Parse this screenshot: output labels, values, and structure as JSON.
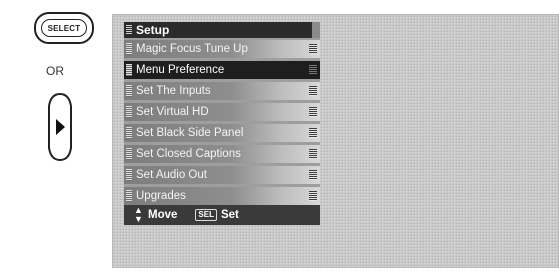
{
  "remote": {
    "select_label": "SELECT",
    "or_label": "OR"
  },
  "menu": {
    "title": "Setup",
    "active_index": 1,
    "items": [
      {
        "label": "Magic Focus Tune Up"
      },
      {
        "label": "Menu Preference"
      },
      {
        "label": "Set The Inputs"
      },
      {
        "label": "Set Virtual HD"
      },
      {
        "label": "Set Black Side Panel"
      },
      {
        "label": "Set Closed Captions"
      },
      {
        "label": "Set Audio Out"
      },
      {
        "label": "Upgrades"
      }
    ],
    "footer": {
      "move_label": "Move",
      "sel_key_label": "SEL",
      "set_label": "Set"
    }
  },
  "icons": {
    "dpad": "dpad-right-arrow-icon",
    "updown": "up-down-arrows-icon"
  }
}
